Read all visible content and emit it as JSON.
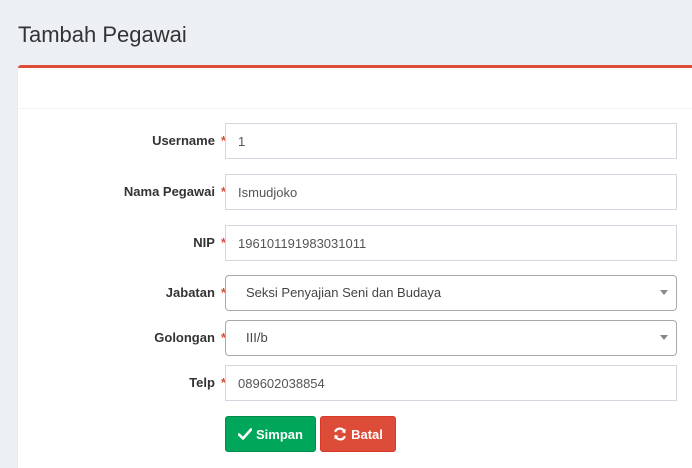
{
  "page": {
    "title": "Tambah Pegawai"
  },
  "form": {
    "fields": [
      {
        "label": "Username",
        "required_mark": "*",
        "value": "1"
      },
      {
        "label": "Nama Pegawai",
        "required_mark": "*",
        "value": "Ismudjoko"
      },
      {
        "label": "NIP",
        "required_mark": "*",
        "value": "196101191983031011"
      },
      {
        "label": "Jabatan",
        "required_mark": "*",
        "value": "Seksi Penyajian Seni dan Budaya"
      },
      {
        "label": "Golongan",
        "required_mark": "*",
        "value": "III/b"
      },
      {
        "label": "Telp",
        "required_mark": "*",
        "value": "089602038854"
      }
    ],
    "buttons": {
      "save_label": "Simpan",
      "save_icon": "check-icon",
      "cancel_label": "Batal",
      "cancel_icon": "refresh-icon"
    }
  },
  "colors": {
    "accent_red": "#dd4b39",
    "success_green": "#00a65a",
    "background": "#ecf0f5"
  }
}
